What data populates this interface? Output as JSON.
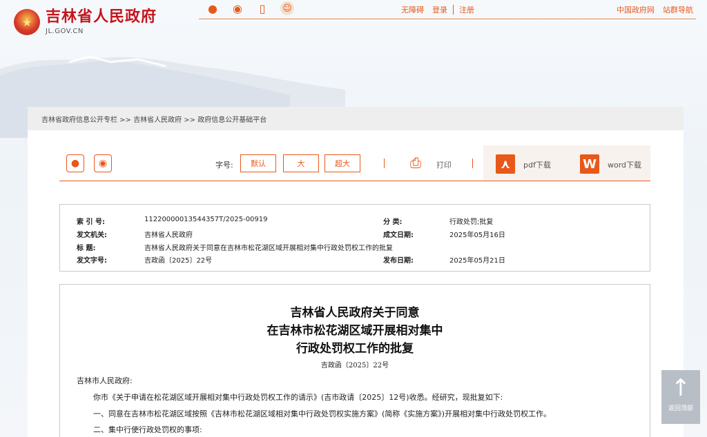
{
  "header": {
    "site_title": "吉林省人民政府",
    "domain": "JL.GOV.CN",
    "top_links": [
      "无障碍",
      "登录",
      "注册"
    ],
    "right_links": [
      "中国政府网",
      "站群导航"
    ]
  },
  "breadcrumb": "吉林省政府信息公开专栏 >> 吉林省人民政府 >> 政府信息公开基础平台",
  "toolbar": {
    "font_size_label": "字号:",
    "font_sizes": [
      "默认",
      "大",
      "超大"
    ],
    "print_label": "打印",
    "pdf_label": "pdf下载",
    "word_label": "word下载"
  },
  "meta": {
    "index_no_label": "索 引 号:",
    "index_no": "11220000013544357T/2025-00919",
    "category_label": "分    类:",
    "category": "行政处罚;批复",
    "issuer_label": "发文机关:",
    "issuer": "吉林省人民政府",
    "date_written_label": "成文日期:",
    "date_written": "2025年05月16日",
    "title_label": "标    题:",
    "title": "吉林省人民政府关于同意在吉林市松花湖区域开展相对集中行政处罚权工作的批复",
    "doc_no_label": "发文字号:",
    "doc_no": "吉政函〔2025〕22号",
    "publish_date_label": "发布日期:",
    "publish_date": "2025年05月21日"
  },
  "document": {
    "title_lines": [
      "吉林省人民政府关于同意",
      "在吉林市松花湖区域开展相对集中",
      "行政处罚权工作的批复"
    ],
    "doc_number": "吉政函〔2025〕22号",
    "salutation": "吉林市人民政府:",
    "paragraphs": [
      "你市《关于申请在松花湖区域开展相对集中行政处罚权工作的请示》(吉市政请〔2025〕12号)收悉。经研究，现批复如下:",
      "一、同意在吉林市松花湖区域按照《吉林市松花湖区域相对集中行政处罚权实施方案》(简称《实施方案》)开展相对集中行政处罚权工作。",
      "二、集中行使行政处罚权的事项:"
    ]
  },
  "back_to_top": "返回顶部",
  "colors": {
    "accent": "#e8581a",
    "brand_red": "#c4161c"
  }
}
